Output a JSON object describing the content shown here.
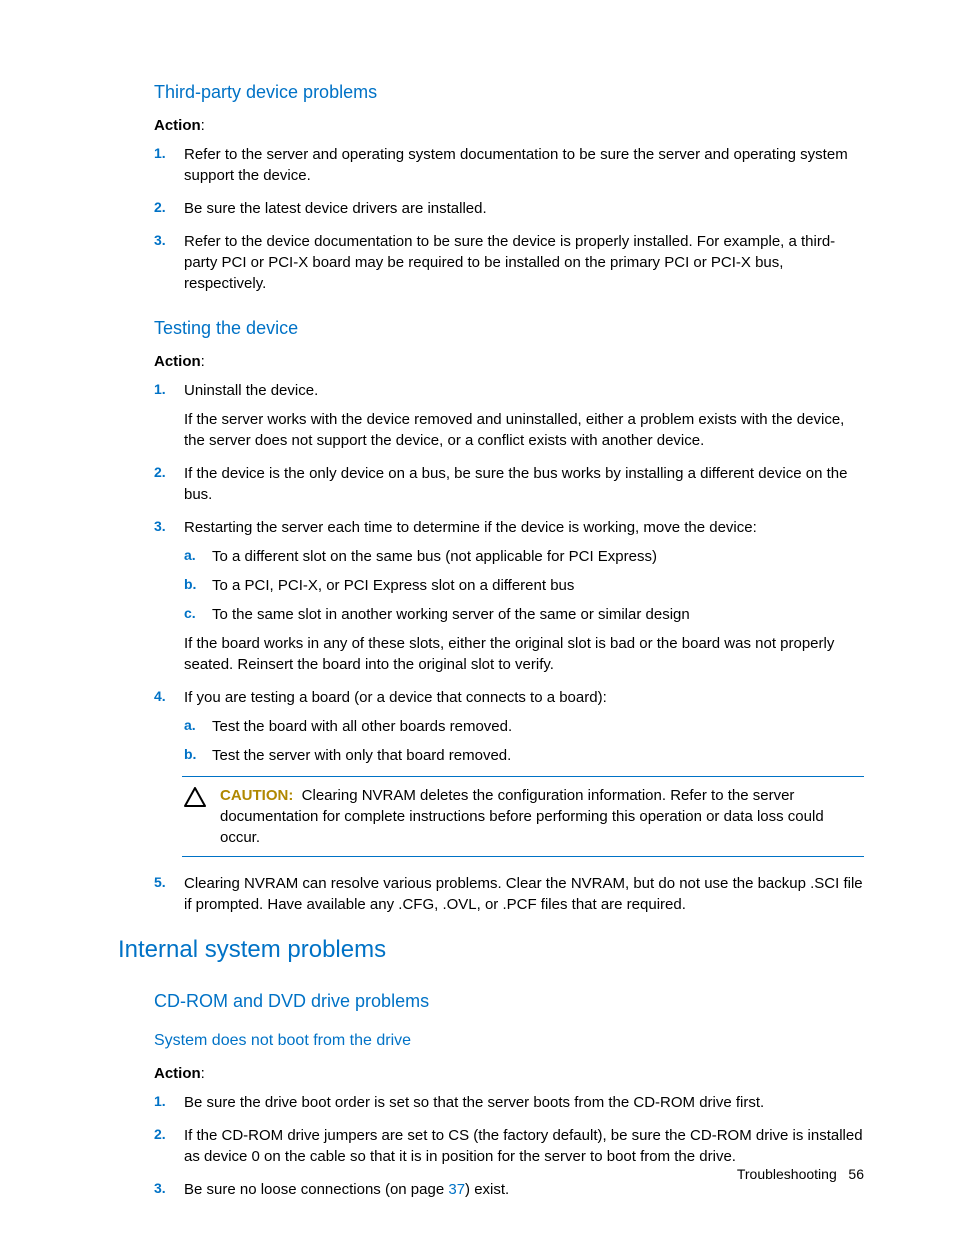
{
  "section1": {
    "heading": "Third-party device problems",
    "action_label": "Action",
    "items": [
      "Refer to the server and operating system documentation to be sure the server and operating system support the device.",
      "Be sure the latest device drivers are installed.",
      "Refer to the device documentation to be sure the device is properly installed. For example, a third-party PCI or PCI-X board may be required to be installed on the primary PCI or PCI-X bus, respectively."
    ]
  },
  "section2": {
    "heading": "Testing the device",
    "action_label": "Action",
    "item1": {
      "lead": "Uninstall the device.",
      "body": "If the server works with the device removed and uninstalled, either a problem exists with the device, the server does not support the device, or a conflict exists with another device."
    },
    "item2": "If the device is the only device on a bus, be sure the bus works by installing a different device on the bus.",
    "item3": {
      "lead": "Restarting the server each time to determine if the device is working, move the device:",
      "subs": [
        "To a different slot on the same bus (not applicable for PCI Express)",
        "To a PCI, PCI-X, or PCI Express slot on a different bus",
        "To the same slot in another working server of the same or similar design"
      ],
      "after": "If the board works in any of these slots, either the original slot is bad or the board was not properly seated. Reinsert the board into the original slot to verify."
    },
    "item4": {
      "lead": "If you are testing a board (or a device that connects to a board):",
      "subs": [
        "Test the board with all other boards removed.",
        "Test the server with only that board removed."
      ]
    },
    "caution": {
      "label": "CAUTION:",
      "text": "Clearing NVRAM deletes the configuration information. Refer to the server documentation for complete instructions before performing this operation or data loss could occur."
    },
    "item5": "Clearing NVRAM can resolve various problems. Clear the NVRAM, but do not use the backup .SCI file if prompted. Have available any .CFG, .OVL, or .PCF files that are required."
  },
  "section3": {
    "heading": "Internal system problems",
    "sub_heading": "CD-ROM and DVD drive problems",
    "subsub_heading": "System does not boot from the drive",
    "action_label": "Action",
    "items": {
      "i1": "Be sure the drive boot order is set so that the server boots from the CD-ROM drive first.",
      "i2": "If the CD-ROM drive jumpers are set to CS (the factory default), be sure the CD-ROM drive is installed as device 0 on the cable so that it is in position for the server to boot from the drive.",
      "i3_pre": "Be sure no loose connections (on page ",
      "i3_link": "37",
      "i3_post": ") exist."
    }
  },
  "footer": {
    "label": "Troubleshooting",
    "page": "56"
  }
}
